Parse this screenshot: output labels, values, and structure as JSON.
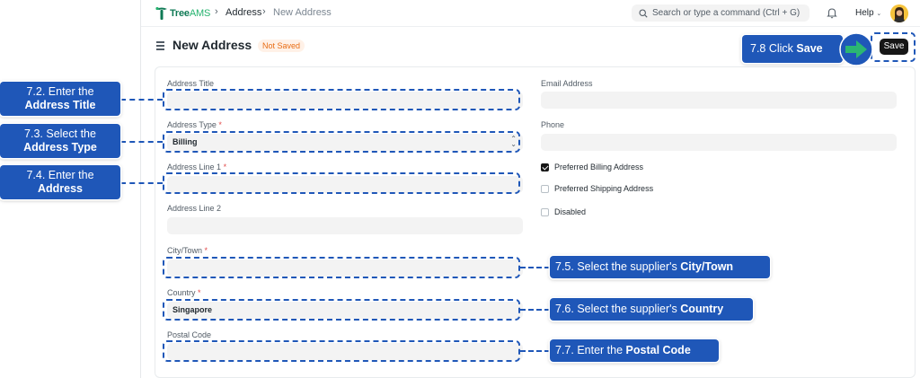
{
  "nav": {
    "logo_main": "Tree",
    "logo_sub": "AMS",
    "breadcrumb_1": "Address",
    "breadcrumb_2": "New Address",
    "search_placeholder": "Search or type a command (Ctrl + G)",
    "help_label": "Help"
  },
  "page": {
    "title": "New Address",
    "status_badge": "Not Saved",
    "save_label": "Save"
  },
  "form": {
    "address_title_label": "Address Title",
    "address_title_value": "",
    "address_type_label": "Address Type",
    "address_type_value": "Billing",
    "address_line1_label": "Address Line 1",
    "address_line1_value": "",
    "address_line2_label": "Address Line 2",
    "address_line2_value": "",
    "city_label": "City/Town",
    "city_value": "",
    "country_label": "Country",
    "country_value": "Singapore",
    "postal_code_label": "Postal Code",
    "postal_code_value": "",
    "email_label": "Email Address",
    "email_value": "",
    "phone_label": "Phone",
    "phone_value": "",
    "required_mark": "*",
    "checkboxes": [
      {
        "label": "Preferred Billing Address",
        "checked": true
      },
      {
        "label": "Preferred Shipping Address",
        "checked": false
      },
      {
        "label": "Disabled",
        "checked": false
      }
    ]
  },
  "annotations": {
    "step_7_2_text": "7.2. Enter the",
    "step_7_2_bold": "Address Title",
    "step_7_3_text": "7.3. Select the",
    "step_7_3_bold": "Address Type",
    "step_7_4_text": "7.4. Enter the",
    "step_7_4_bold": "Address",
    "step_7_5_text": "7.5. Select the supplier's ",
    "step_7_5_bold": "City/Town",
    "step_7_6_text": "7.6. Select the supplier's ",
    "step_7_6_bold": "Country",
    "step_7_7_text": "7.7. Enter the ",
    "step_7_7_bold": "Postal Code",
    "step_7_8_text": "7.8 Click ",
    "step_7_8_bold": "Save"
  },
  "colors": {
    "annotation_blue": "#1f57b8",
    "arrow_green": "#2bb673",
    "badge_orange": "#e86c13",
    "save_button": "#171717"
  },
  "icons": {
    "search": "search-icon",
    "bell": "bell-icon",
    "chevron": "chevron-down-icon",
    "menu": "hamburger-icon",
    "select": "select-chevrons-icon",
    "arrow": "arrow-right-icon"
  }
}
